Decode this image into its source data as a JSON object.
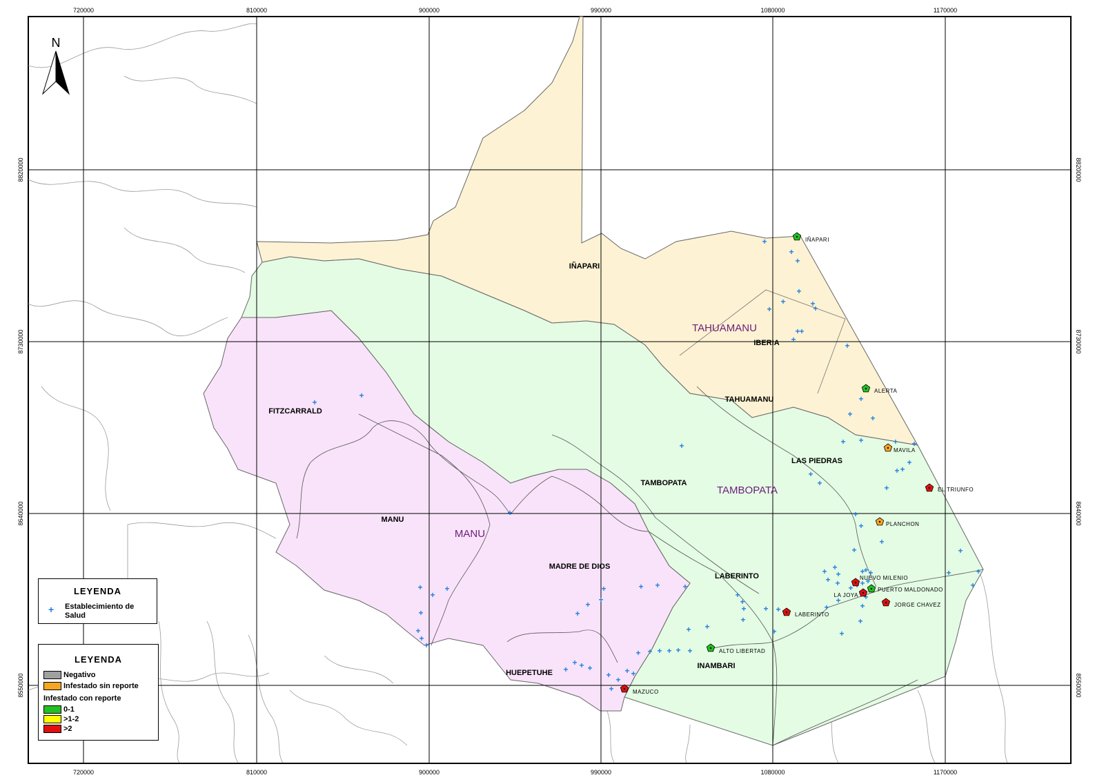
{
  "north_label": "N",
  "grid": {
    "x_ticks": [
      "720000",
      "810000",
      "900000",
      "990000",
      "1080000",
      "1170000"
    ],
    "y_ticks": [
      "8820000",
      "8730000",
      "8640000",
      "8550000"
    ]
  },
  "provinces": [
    "TAHUAMANU",
    "TAMBOPATA",
    "MANU"
  ],
  "districts": [
    "IÑAPARI",
    "IBERIA",
    "TAHUAMANU",
    "FITZCARRALD",
    "LAS PIEDRAS",
    "TAMBOPATA",
    "MANU",
    "MADRE DE DIOS",
    "LABERINTO",
    "INAMBARI",
    "HUEPETUHE"
  ],
  "localities": [
    {
      "name": "IÑAPARI",
      "status": "0-1"
    },
    {
      "name": "ALERTA",
      "status": "0-1"
    },
    {
      "name": "MAVILA",
      "status": "Infestado sin reporte"
    },
    {
      "name": "EL TRIUNFO",
      "status": ">2"
    },
    {
      "name": "PLANCHON",
      "status": "Infestado sin reporte"
    },
    {
      "name": "NUEVO MILENIO",
      "status": ">2"
    },
    {
      "name": "PUERTO MALDONADO",
      "status": "0-1"
    },
    {
      "name": "LA JOYA",
      "status": ">2"
    },
    {
      "name": "JORGE CHAVEZ",
      "status": ">2"
    },
    {
      "name": "LABERINTO",
      "status": ">2"
    },
    {
      "name": "ALTO LIBERTAD",
      "status": "0-1"
    },
    {
      "name": "MAZUCO",
      "status": ">2"
    }
  ],
  "legend1": {
    "title": "LEYENDA",
    "item": "Establecimiento de Salud"
  },
  "legend2": {
    "title": "LEYENDA",
    "items": [
      "Negativo",
      "Infestado sin reporte"
    ],
    "subtitle": "Infestado con reporte",
    "subitems": [
      "0-1",
      ">1-2",
      ">2"
    ]
  },
  "colors": {
    "tahuamanu": "#fdf2d3",
    "tambopata": "#e4fbe4",
    "manu": "#f9e3fa",
    "health_facility": "#1f7fe0",
    "negativo": "#a0a0a0",
    "infestado_sin_reporte": "#f5a623",
    "range_0_1": "#22c022",
    "range_1_2": "#ffff00",
    "range_gt_2": "#e01010",
    "province_label": "#6a1f7a"
  }
}
